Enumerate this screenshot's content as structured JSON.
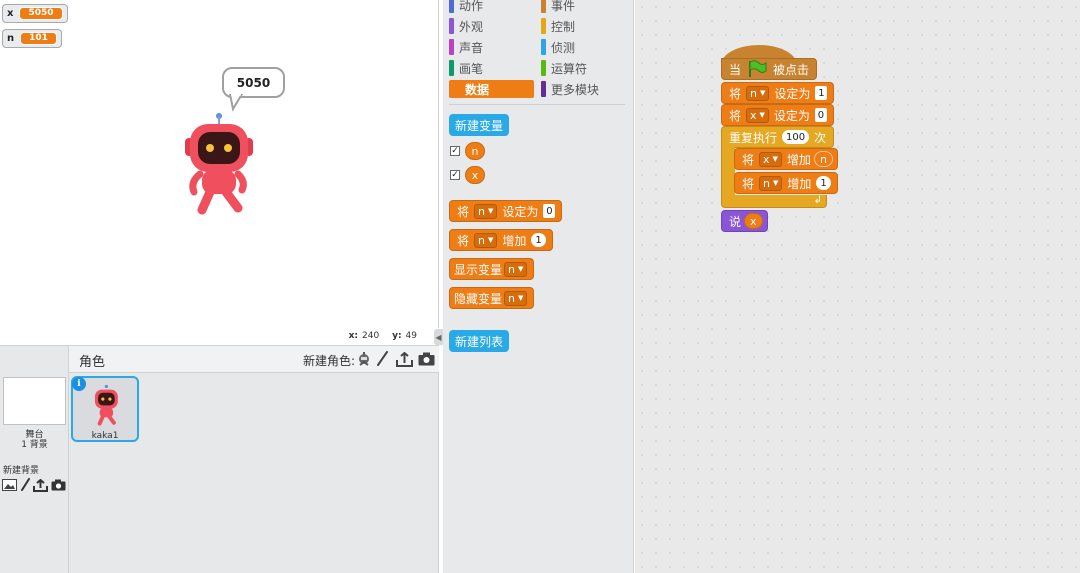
{
  "stage": {
    "monitors": [
      {
        "name": "x",
        "value": "5050"
      },
      {
        "name": "n",
        "value": "101"
      }
    ],
    "speech_bubble": "5050",
    "coords": {
      "x_label": "x:",
      "x_value": "240",
      "y_label": "y:",
      "y_value": "49"
    }
  },
  "sprite_pane": {
    "title": "角色",
    "new_sprite_label": "新建角色:",
    "stage_label": "舞台",
    "stage_backdrops": "1 背景",
    "new_backdrop_label": "新建背景",
    "sprites": [
      {
        "name": "kaka1"
      }
    ]
  },
  "palette": {
    "categories": [
      {
        "label": "动作",
        "color": "#4a6cd4"
      },
      {
        "label": "事件",
        "color": "#c88330"
      },
      {
        "label": "外观",
        "color": "#8a55d7"
      },
      {
        "label": "控制",
        "color": "#e1a91a"
      },
      {
        "label": "声音",
        "color": "#bb42c3"
      },
      {
        "label": "侦测",
        "color": "#2ca5e2"
      },
      {
        "label": "画笔",
        "color": "#0e9a6c"
      },
      {
        "label": "运算符",
        "color": "#5cb712"
      },
      {
        "label": "数据",
        "color": "#ee7d16"
      },
      {
        "label": "更多模块",
        "color": "#632d99"
      }
    ],
    "new_variable_button": "新建变量",
    "variables": [
      "n",
      "x"
    ],
    "blocks": {
      "set": {
        "word": "将",
        "var": "n",
        "action": "设定为",
        "value": "0"
      },
      "change": {
        "word": "将",
        "var": "n",
        "action": "增加",
        "value": "1"
      },
      "show": {
        "label": "显示变量",
        "var": "n"
      },
      "hide": {
        "label": "隐藏变量",
        "var": "n"
      }
    },
    "new_list_button": "新建列表"
  },
  "script": {
    "hat": {
      "when": "当",
      "clicked": "被点击"
    },
    "set_n": {
      "word": "将",
      "var": "n",
      "action": "设定为",
      "value": "1"
    },
    "set_x": {
      "word": "将",
      "var": "x",
      "action": "设定为",
      "value": "0"
    },
    "repeat": {
      "label": "重复执行",
      "count": "100",
      "unit": "次"
    },
    "change_x": {
      "word": "将",
      "var": "x",
      "action": "增加",
      "value": "n"
    },
    "change_n": {
      "word": "将",
      "var": "n",
      "action": "增加",
      "value": "1"
    },
    "say": {
      "label": "说",
      "value": "x"
    }
  },
  "colors": {
    "data": "#ee7d16",
    "control": "#e6a822",
    "events": "#c88330",
    "looks": "#8a55d7",
    "button": "#29a9e6",
    "selected": "#29a9e6"
  },
  "icons": [
    "green-flag-icon",
    "paint-brush-icon",
    "upload-icon",
    "camera-icon",
    "sprite-library-icon",
    "backdrop-library-icon",
    "info-icon"
  ]
}
